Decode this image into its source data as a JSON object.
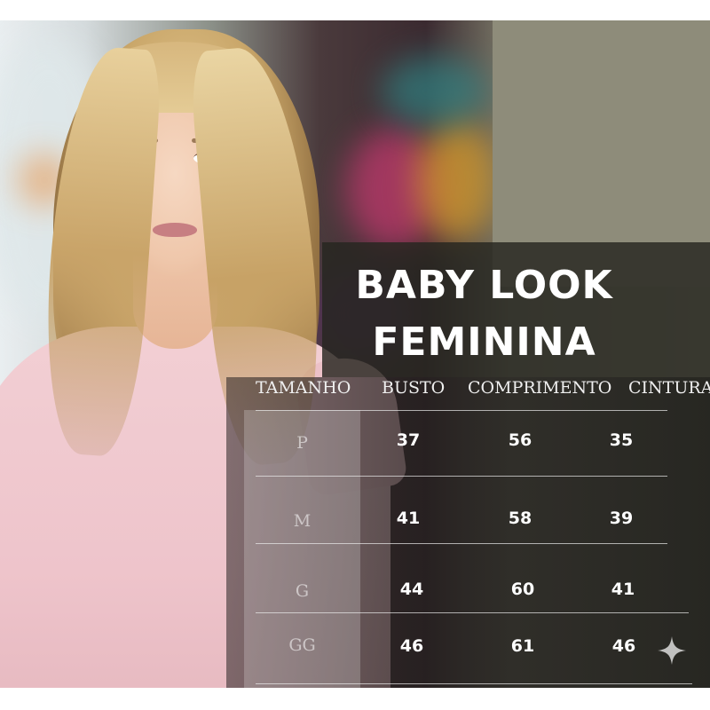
{
  "title": {
    "line1": "BABY LOOK",
    "line2": "FEMININA"
  },
  "table": {
    "headers": [
      "TAMANHO",
      "BUSTO",
      "COMPRIMENTO",
      "CINTURA"
    ],
    "rows": [
      {
        "size": "P",
        "busto": "37",
        "comprimento": "56",
        "cintura": "35"
      },
      {
        "size": "M",
        "busto": "41",
        "comprimento": "58",
        "cintura": "39"
      },
      {
        "size": "G",
        "busto": "44",
        "comprimento": "60",
        "cintura": "41"
      },
      {
        "size": "GG",
        "busto": "46",
        "comprimento": "61",
        "cintura": "46"
      }
    ]
  },
  "colors": {
    "shirt": "#eec4cb",
    "panel": "#26261f",
    "text": "#ffffff"
  },
  "icons": {
    "corner": "sparkle-icon"
  }
}
